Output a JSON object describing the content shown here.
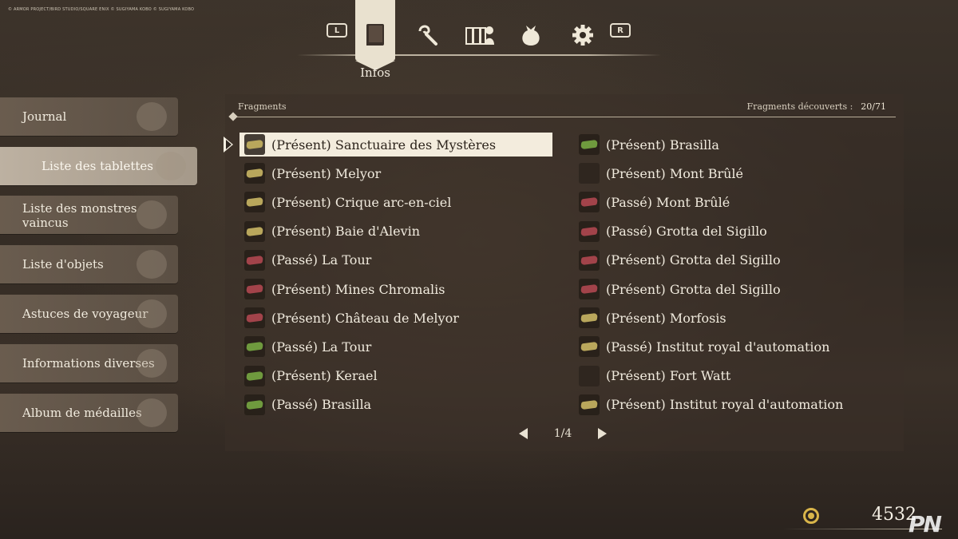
{
  "copyright": "© ARMOR PROJECT/BIRD STUDIO/SQUARE ENIX © SUGIYAMA KOBO © SUGIYAMA KOBO",
  "topnav": {
    "left_shoulder": "L",
    "right_shoulder": "R",
    "tabs": [
      {
        "icon": "book-icon"
      },
      {
        "icon": "wand-icon"
      },
      {
        "icon": "party-icon"
      },
      {
        "icon": "bag-icon"
      },
      {
        "icon": "gear-icon"
      }
    ],
    "active_label": "Infos"
  },
  "sidebar": {
    "items": [
      {
        "label": "Journal",
        "icon": "book-icon"
      },
      {
        "label": "Liste des tablettes",
        "icon": "tablet-icon",
        "active": true
      },
      {
        "label": "Liste des monstres vaincus",
        "icon": "slime-icon"
      },
      {
        "label": "Liste d'objets",
        "icon": "bag-icon"
      },
      {
        "label": "Astuces de voyageur",
        "icon": "scroll-icon"
      },
      {
        "label": "Informations diverses",
        "icon": "quill-icon"
      },
      {
        "label": "Album de médailles",
        "icon": "medal-icon"
      }
    ]
  },
  "panel": {
    "title": "Fragments",
    "counter_label": "Fragments découverts :",
    "counter_value": "20/71",
    "left_list": [
      {
        "label": "(Présent) Sanctuaire des Mystères",
        "color": "#b9a75c",
        "selected": true
      },
      {
        "label": "(Présent) Melyor",
        "color": "#b9a75c"
      },
      {
        "label": "(Présent) Crique arc-en-ciel",
        "color": "#b9a75c"
      },
      {
        "label": "(Présent) Baie d'Alevin",
        "color": "#b9a75c"
      },
      {
        "label": "(Passé) La Tour",
        "color": "#a2434a"
      },
      {
        "label": "(Présent) Mines Chromalis",
        "color": "#a2434a"
      },
      {
        "label": "(Présent) Château de Melyor",
        "color": "#a2434a"
      },
      {
        "label": "(Passé) La Tour",
        "color": "#6f9a3e"
      },
      {
        "label": "(Présent) Kerael",
        "color": "#6f9a3e"
      },
      {
        "label": "(Passé) Brasilla",
        "color": "#6f9a3e"
      }
    ],
    "right_list": [
      {
        "label": "(Présent) Brasilla",
        "color": "#6f9a3e"
      },
      {
        "label": "(Présent) Mont Brûlé",
        "color": ""
      },
      {
        "label": "(Passé) Mont Brûlé",
        "color": "#a2434a"
      },
      {
        "label": "(Passé) Grotta del Sigillo",
        "color": "#a2434a"
      },
      {
        "label": "(Présent) Grotta del Sigillo",
        "color": "#a2434a"
      },
      {
        "label": "(Présent) Grotta del Sigillo",
        "color": "#a2434a"
      },
      {
        "label": "(Présent) Morfosis",
        "color": "#b9a75c"
      },
      {
        "label": "(Passé) Institut royal d'automation",
        "color": "#b9a75c"
      },
      {
        "label": "(Présent) Fort Watt",
        "color": ""
      },
      {
        "label": "(Présent) Institut royal d'automation",
        "color": "#b9a75c"
      }
    ]
  },
  "pager": {
    "text": "1/4"
  },
  "gold": {
    "value": "4532",
    "icon": "coin-icon"
  },
  "watermark": "PN"
}
